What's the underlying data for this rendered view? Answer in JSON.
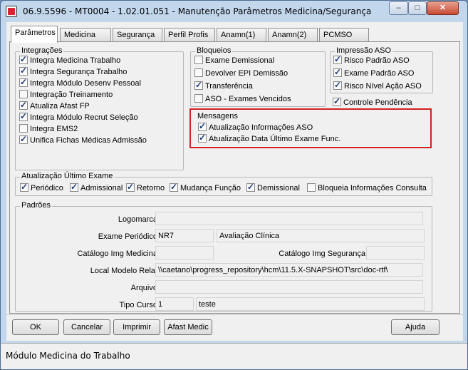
{
  "window": {
    "title": "06.9.5596 - MT0004 - 1.02.01.051 - Manutenção Parâmetros Medicina/Segurança",
    "min_label": "–",
    "max_label": "□",
    "close_label": "✕"
  },
  "tabs": [
    "Parâmetros",
    "Medicina",
    "Segurança",
    "Perfil Profis",
    "Anamn(1)",
    "Anamn(2)",
    "PCMSO"
  ],
  "integracoes": {
    "title": "Integrações",
    "items": [
      {
        "label": "Integra Medicina Trabalho",
        "checked": true
      },
      {
        "label": "Integra Segurança Trabalho",
        "checked": true
      },
      {
        "label": "Integra Módulo Desenv Pessoal",
        "checked": true
      },
      {
        "label": "Integração Treinamento",
        "checked": false
      },
      {
        "label": "Atualiza Afast FP",
        "checked": true
      },
      {
        "label": "Integra Módulo Recrut Seleção",
        "checked": true
      },
      {
        "label": "Integra EMS2",
        "checked": false
      },
      {
        "label": "Unifica Fichas Médicas Admissão",
        "checked": true
      }
    ]
  },
  "bloqueios": {
    "title": "Bloqueios",
    "items": [
      {
        "label": "Exame Demissional",
        "checked": false
      },
      {
        "label": "Devolver EPI Demissão",
        "checked": false
      },
      {
        "label": "Transferência",
        "checked": true
      },
      {
        "label": "ASO - Exames Vencidos",
        "checked": false
      }
    ]
  },
  "impressao": {
    "title": "Impressão ASO",
    "items": [
      {
        "label": "Risco Padrão ASO",
        "checked": true
      },
      {
        "label": "Exame Padrão ASO",
        "checked": true
      },
      {
        "label": "Risco Nível Ação ASO",
        "checked": true
      }
    ]
  },
  "controle_pendencia": {
    "label": "Controle Pendência",
    "checked": true
  },
  "mensagens": {
    "title": "Mensagens",
    "items": [
      {
        "label": "Atualização Informações ASO",
        "checked": true
      },
      {
        "label": "Atualização Data Último Exame Func.",
        "checked": true
      }
    ]
  },
  "ultimo_exame": {
    "title": "Atualização Último Exame",
    "items": [
      {
        "label": "Periódico",
        "checked": true
      },
      {
        "label": "Admissional",
        "checked": true
      },
      {
        "label": "Retorno",
        "checked": true
      },
      {
        "label": "Mudança Função",
        "checked": true
      },
      {
        "label": "Demissional",
        "checked": true
      },
      {
        "label": "Bloqueia Informações Consulta",
        "checked": false
      }
    ]
  },
  "padroes": {
    "title": "Padrões",
    "logomarca_label": "Logomarca:",
    "logomarca_value": "",
    "exame_periodico_label": "Exame Periódico:",
    "exame_periodico_code": "NR7",
    "exame_periodico_desc": "Avaliação Clínica",
    "catalogo_medicina_label": "Catálogo Img Medicina:",
    "catalogo_medicina_value": "",
    "catalogo_seguranca_label": "Catálogo Img Segurança:",
    "catalogo_seguranca_value": "",
    "local_modelo_label": "Local Modelo Relat:",
    "local_modelo_value": "\\\\caetano\\progress_repository\\hcm\\11.5.X-SNAPSHOT\\src\\doc-rtf\\",
    "arquivo_label": "Arquivo:",
    "arquivo_value": "",
    "tipo_curso_label": "Tipo Curso:",
    "tipo_curso_code": "1",
    "tipo_curso_desc": "teste"
  },
  "buttons": {
    "ok": "OK",
    "cancelar": "Cancelar",
    "imprimir": "Imprimir",
    "afast_medic": "Afast Medic",
    "ajuda": "Ajuda"
  },
  "status": "Módulo Medicina do Trabalho"
}
